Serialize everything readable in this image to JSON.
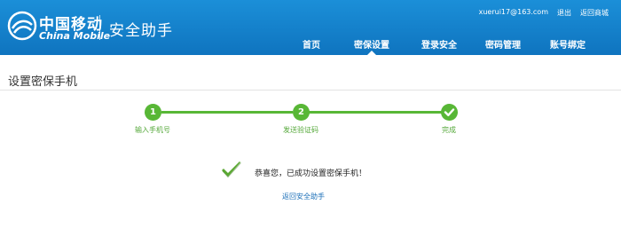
{
  "header": {
    "brand_cn": "中国移动",
    "brand_en": "China Mobile",
    "app_title": "安全助手",
    "user_email": "xuerui17@163.com",
    "logout": "退出",
    "back_to_mall": "返回商城",
    "colors": {
      "header_bg": "#1582cf",
      "accent_green": "#58b736",
      "link_blue": "#1b6fb8"
    }
  },
  "nav": {
    "items": [
      {
        "label": "首页"
      },
      {
        "label": "密保设置",
        "active": true
      },
      {
        "label": "登录安全"
      },
      {
        "label": "密码管理"
      },
      {
        "label": "账号绑定"
      }
    ]
  },
  "main": {
    "page_title": "设置密保手机",
    "steps": [
      {
        "number": "1",
        "label": "输入手机号"
      },
      {
        "number": "2",
        "label": "发送验证码"
      },
      {
        "number": "",
        "label": "完成",
        "icon": "check-icon"
      }
    ],
    "success_message": "恭喜您，已成功设置密保手机！",
    "back_link": "返回安全助手"
  }
}
